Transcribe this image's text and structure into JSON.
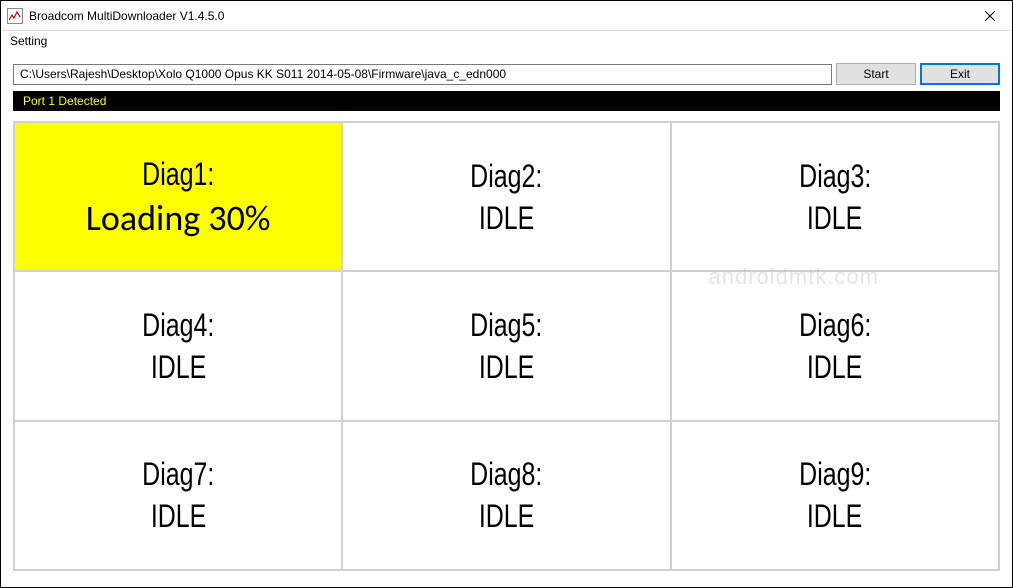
{
  "window": {
    "title": "Broadcom MultiDownloader V1.4.5.0"
  },
  "menu": {
    "setting": "Setting"
  },
  "toolbar": {
    "path": "C:\\Users\\Rajesh\\Desktop\\Xolo Q1000 Opus KK S011 2014-05-08\\Firmware\\java_c_edn000",
    "start_label": "Start",
    "exit_label": "Exit"
  },
  "status_strip": "Port 1 Detected",
  "cells": [
    {
      "title": "Diag1:",
      "status": "Loading 30%",
      "active": true
    },
    {
      "title": "Diag2:",
      "status": "IDLE",
      "active": false
    },
    {
      "title": "Diag3:",
      "status": "IDLE",
      "active": false
    },
    {
      "title": "Diag4:",
      "status": "IDLE",
      "active": false
    },
    {
      "title": "Diag5:",
      "status": "IDLE",
      "active": false
    },
    {
      "title": "Diag6:",
      "status": "IDLE",
      "active": false
    },
    {
      "title": "Diag7:",
      "status": "IDLE",
      "active": false
    },
    {
      "title": "Diag8:",
      "status": "IDLE",
      "active": false
    },
    {
      "title": "Diag9:",
      "status": "IDLE",
      "active": false
    }
  ],
  "watermark": "androidmtk.com"
}
